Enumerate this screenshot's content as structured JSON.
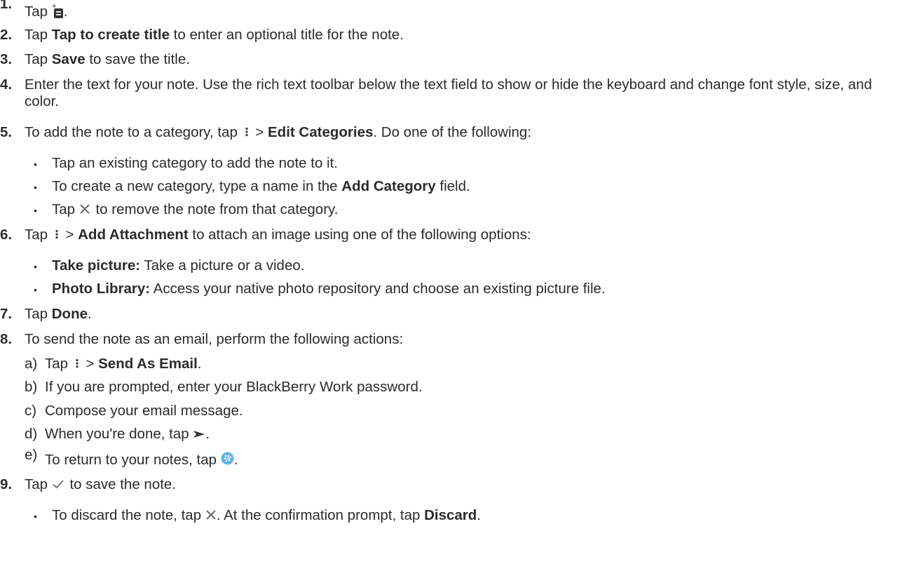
{
  "colors": {
    "text": "#2b2b2b",
    "icon": "#333333",
    "icon_light": "#6b6b6b",
    "bb_blue": "#63b3e8"
  },
  "steps": [
    {
      "n": "1.",
      "pre": "Tap ",
      "icon": "new-note-icon",
      "post": "."
    },
    {
      "n": "2.",
      "pre": "Tap ",
      "bold": "Tap to create title",
      "post": " to enter an optional title for the note."
    },
    {
      "n": "3.",
      "pre": "Tap ",
      "bold": "Save",
      "post": " to save the title."
    },
    {
      "n": "4.",
      "text": "Enter the text for your note. Use the rich text toolbar below the text field to show or hide the keyboard and change font style, size, and color."
    },
    {
      "n": "5.",
      "pre": "To add the note to a category, tap ",
      "icon": "more-options-icon",
      "mid": " > ",
      "bold": "Edit Categories",
      "post": ". Do one of the following:",
      "bullets": [
        {
          "text": "Tap an existing category to add the note to it."
        },
        {
          "pre": "To create a new category, type a name in the ",
          "bold": "Add Category",
          "post": " field."
        },
        {
          "pre": "Tap ",
          "icon": "close-icon",
          "post": " to remove the note from that category."
        }
      ]
    },
    {
      "n": "6.",
      "pre": "Tap ",
      "icon": "more-options-icon",
      "mid": " > ",
      "bold": "Add Attachment",
      "post": " to attach an image using one of the following options:",
      "bullets": [
        {
          "bold": "Take picture:",
          "post": " Take a picture or a video."
        },
        {
          "bold": "Photo Library:",
          "post": " Access your native photo repository and choose an existing picture file."
        }
      ]
    },
    {
      "n": "7.",
      "pre": "Tap ",
      "bold": "Done",
      "post": "."
    },
    {
      "n": "8.",
      "text": "To send the note as an email, perform the following actions:",
      "substeps": [
        {
          "l": "a)",
          "pre": "Tap ",
          "icon": "more-options-icon",
          "mid": " > ",
          "bold": "Send As Email",
          "post": "."
        },
        {
          "l": "b)",
          "text": "If you are prompted, enter your BlackBerry Work password."
        },
        {
          "l": "c)",
          "text": "Compose your email message."
        },
        {
          "l": "d)",
          "pre": "When you're done, tap ",
          "icon": "send-icon",
          "post": "."
        },
        {
          "l": "e)",
          "pre": "To return to your notes, tap ",
          "icon": "blackberry-icon",
          "post": "."
        }
      ]
    },
    {
      "n": "9.",
      "pre": "Tap ",
      "icon": "checkmark-icon",
      "post": " to save the note.",
      "bullets": [
        {
          "pre": "To discard the note, tap ",
          "icon": "close-icon",
          "mid": ". At the confirmation prompt, tap ",
          "bold": "Discard",
          "post": "."
        }
      ]
    }
  ]
}
